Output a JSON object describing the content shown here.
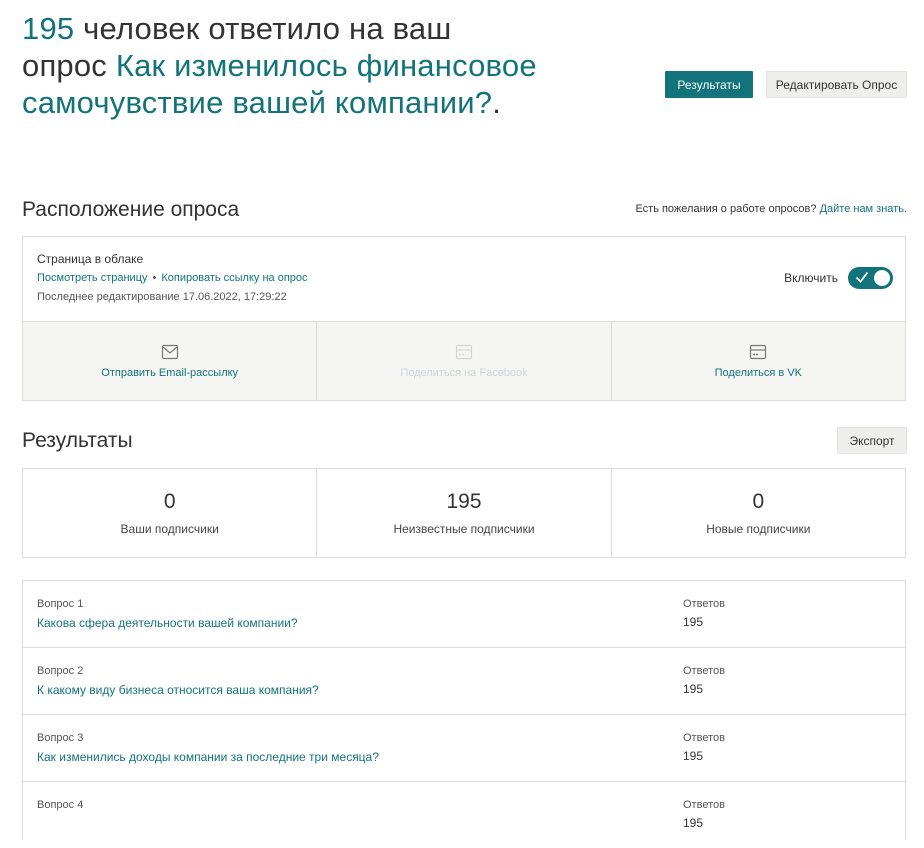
{
  "header": {
    "count": "195",
    "text_mid": " человек ответило на ваш опрос ",
    "survey_name": "Как изменилось финансовое самочувствие вашей компании?",
    "text_end": "."
  },
  "actions": {
    "results_label": "Результаты",
    "edit_label": "Редактировать Опрос"
  },
  "location": {
    "title": "Расположение опроса",
    "feedback_text": "Есть пожелания о работе опросов?",
    "feedback_link": "Дайте нам знать.",
    "page_label": "Страница в облаке",
    "view_link": "Посмотреть страницу",
    "separator": "•",
    "copy_link": "Копировать ссылку на опрос",
    "last_edited": "Последнее редактирование 17.06.2022, 17:29:22",
    "toggle_label": "Включить",
    "toggle_on": true,
    "share": [
      {
        "label": "Отправить Email-рассылку",
        "icon": "email-icon",
        "enabled": true
      },
      {
        "label": "Поделиться на Facebook",
        "icon": "card-icon",
        "enabled": false
      },
      {
        "label": "Поделиться в VK",
        "icon": "card-icon",
        "enabled": true
      }
    ]
  },
  "results": {
    "title": "Результаты",
    "export_label": "Экспорт",
    "stats": [
      {
        "value": "0",
        "label": "Ваши подписчики"
      },
      {
        "value": "195",
        "label": "Неизвестные подписчики"
      },
      {
        "value": "0",
        "label": "Новые подписчики"
      }
    ]
  },
  "questions": [
    {
      "num": "Вопрос 1",
      "text": "Какова сфера деятельности вашей компании?",
      "answers_label": "Ответов",
      "answers": "195"
    },
    {
      "num": "Вопрос 2",
      "text": "К какому виду бизнеса относится ваша компания?",
      "answers_label": "Ответов",
      "answers": "195"
    },
    {
      "num": "Вопрос 3",
      "text": "Как изменились доходы компании за последние три месяца?",
      "answers_label": "Ответов",
      "answers": "195"
    },
    {
      "num": "Вопрос 4",
      "text": "",
      "answers_label": "Ответов",
      "answers": "195"
    }
  ],
  "colors": {
    "accent": "#12747a",
    "panel_bg": "#f5f5f4",
    "border": "#dcdcdc"
  }
}
